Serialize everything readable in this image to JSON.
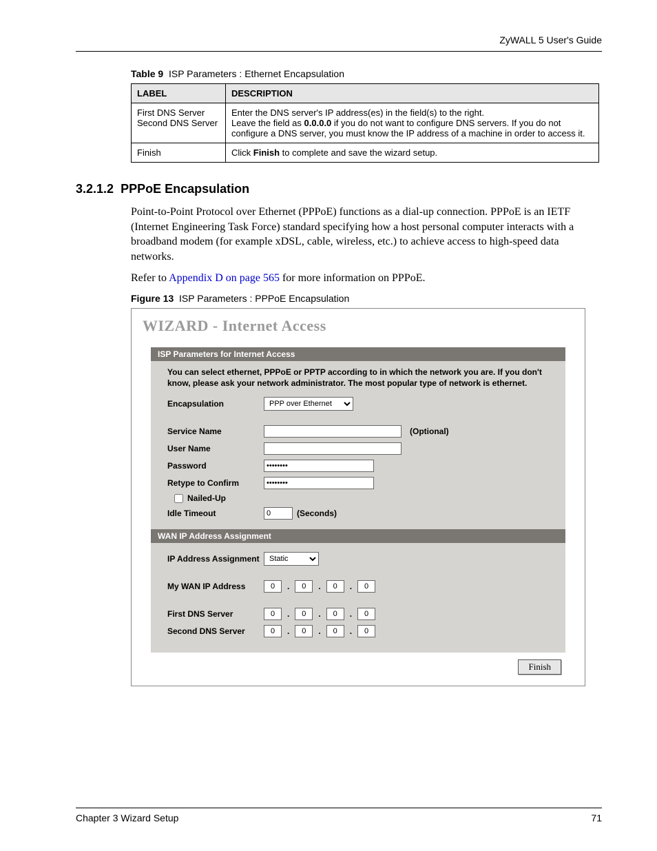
{
  "header": {
    "running": "ZyWALL 5 User's Guide"
  },
  "table9": {
    "caption_label": "Table 9",
    "caption_text": "ISP Parameters : Ethernet Encapsulation",
    "head": {
      "label": "LABEL",
      "desc": "DESCRIPTION"
    },
    "row1": {
      "label_a": "First DNS Server",
      "label_b": "Second DNS Server",
      "desc_a": "Enter the DNS server's IP address(es) in the field(s) to the right.",
      "desc_b1": "Leave the field as ",
      "desc_b_bold": "0.0.0.0",
      "desc_b2": " if you do not want to configure DNS servers. If you do not configure a DNS server, you must know the IP address of a machine in order to access it."
    },
    "row2": {
      "label": "Finish",
      "desc_a": "Click ",
      "desc_bold": "Finish",
      "desc_b": " to complete and save the wizard setup."
    }
  },
  "section": {
    "num": "3.2.1.2",
    "title": "PPPoE Encapsulation",
    "p1": "Point-to-Point Protocol over Ethernet (PPPoE) functions as a dial-up connection. PPPoE is an IETF (Internet Engineering Task Force) standard specifying how a host personal computer interacts with a broadband modem (for example xDSL, cable, wireless, etc.) to achieve access to high-speed data networks.",
    "p2_a": "Refer to ",
    "p2_link": "Appendix D on page 565",
    "p2_b": " for more information on PPPoE."
  },
  "figure13": {
    "caption_label": "Figure 13",
    "caption_text": "ISP Parameters : PPPoE Encapsulation"
  },
  "wizard": {
    "title": "WIZARD - Internet Access",
    "panel1": {
      "header": "ISP Parameters for Internet Access",
      "intro": "You can select ethernet, PPPoE or PPTP according to in which the network you are. If you don't know, please ask your network administrator. The most popular type of network is ethernet.",
      "encapsulation_label": "Encapsulation",
      "encapsulation_value": "PPP over Ethernet",
      "service_name_label": "Service Name",
      "service_name_value": "",
      "optional": "(Optional)",
      "user_name_label": "User Name",
      "user_name_value": "",
      "password_label": "Password",
      "password_value": "********",
      "retype_label": "Retype to Confirm",
      "retype_value": "********",
      "nailed_up_label": "Nailed-Up",
      "idle_timeout_label": "Idle Timeout",
      "idle_timeout_value": "0",
      "seconds_label": "(Seconds)"
    },
    "panel2": {
      "header": "WAN IP Address Assignment",
      "ip_assign_label": "IP Address Assignment",
      "ip_assign_value": "Static",
      "my_wan_label": "My WAN IP Address",
      "first_dns_label": "First DNS Server",
      "second_dns_label": "Second DNS Server",
      "ip": {
        "a": "0",
        "b": "0",
        "c": "0",
        "d": "0"
      }
    },
    "finish_button": "Finish"
  },
  "footer": {
    "chapter": "Chapter 3 Wizard Setup",
    "page": "71"
  }
}
